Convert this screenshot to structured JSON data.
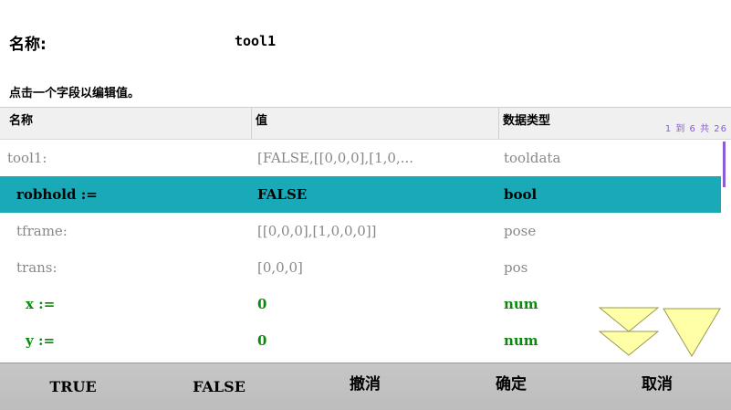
{
  "header": {
    "name_label": "名称:",
    "name_value": "tool1",
    "instruction": "点击一个字段以编辑值。"
  },
  "table": {
    "columns": [
      "名称",
      "值",
      "数据类型"
    ],
    "counter": "1 到 6 共 26",
    "rows": [
      {
        "name": "tool1:",
        "value": "[FALSE,[[0,0,0],[1,0,...",
        "type": "tooldata",
        "style": "dim",
        "indent": 0
      },
      {
        "name": "robhold :=",
        "value": "FALSE",
        "type": "bool",
        "style": "selected",
        "indent": 1
      },
      {
        "name": "tframe:",
        "value": "[[0,0,0],[1,0,0,0]]",
        "type": "pose",
        "style": "dim",
        "indent": 1
      },
      {
        "name": "trans:",
        "value": "[0,0,0]",
        "type": "pos",
        "style": "dim",
        "indent": 2
      },
      {
        "name": "x :=",
        "value": "0",
        "type": "num",
        "style": "green",
        "indent": 3
      },
      {
        "name": "y :=",
        "value": "0",
        "type": "num",
        "style": "green",
        "indent": 3
      }
    ]
  },
  "scroll": {
    "up_icon": "scroll-up-double-triangle-icon",
    "down_icon": "scroll-down-triangle-icon",
    "accent": "#8a5cd6",
    "arrow_fill": "#ffffa8"
  },
  "footer": {
    "true_label": "TRUE",
    "false_label": "FALSE",
    "undo_label": "撤消",
    "confirm_label": "确定",
    "cancel_label": "取消"
  },
  "colors": {
    "selected_row": "#1aa9b7",
    "editable_text": "#0a8a0a",
    "readonly_text": "#888888",
    "footer_bg": "#c2c2c2"
  }
}
